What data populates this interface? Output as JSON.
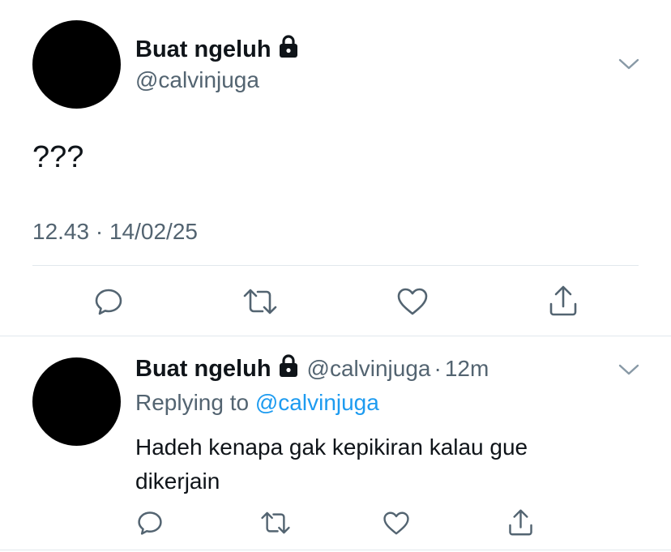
{
  "main_tweet": {
    "display_name": "Buat ngeluh",
    "username": "@calvinjuga",
    "text": "???",
    "time": "12.43",
    "separator": "·",
    "date": "14/02/25",
    "icons": {
      "lock": "lock-icon",
      "menu": "chevron-down-icon",
      "reply": "reply-icon",
      "retweet": "retweet-icon",
      "like": "heart-icon",
      "share": "share-icon"
    }
  },
  "reply_tweet": {
    "display_name": "Buat ngeluh",
    "username": "@calvinjuga",
    "separator": "·",
    "time_ago": "12m",
    "replying_to_label": "Replying to",
    "replying_to_handle": "@calvinjuga",
    "text_line_1": "Hadeh kenapa gak kepikiran kalau gue",
    "text_line_2": "dikerjain"
  },
  "colors": {
    "text": "#0f1419",
    "muted": "#536471",
    "link": "#1d9bf0",
    "divider": "#e1e8ed",
    "avatar": "#000000"
  }
}
